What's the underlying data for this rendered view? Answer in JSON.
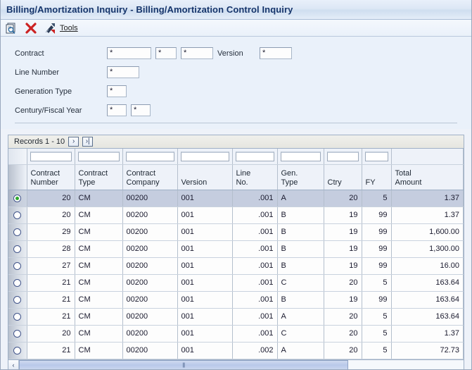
{
  "window": {
    "title": "Billing/Amortization Inquiry - Billing/Amortization Control Inquiry"
  },
  "toolbar": {
    "find_icon": "find-magnifier-icon",
    "delete_icon": "red-x-delete-icon",
    "tools_icon": "tools-wrench-icon",
    "tools_label": "Tools"
  },
  "form": {
    "rows": [
      {
        "label": "Contract",
        "fields": [
          "*",
          "*",
          "*"
        ],
        "second_label": "Version",
        "second_fields": [
          "*"
        ]
      },
      {
        "label": "Line Number",
        "fields": [
          "*"
        ]
      },
      {
        "label": "Generation Type",
        "fields": [
          "*"
        ]
      },
      {
        "label": "Century/Fiscal Year",
        "fields": [
          "*",
          "*"
        ]
      }
    ]
  },
  "grid": {
    "records_label": "Records  1 - 10",
    "next_button": "›",
    "last_button": "›|",
    "qbe_values": [
      "",
      "",
      "",
      "",
      "",
      "",
      "",
      ""
    ],
    "columns": [
      {
        "line1": "Contract",
        "line2": "Number",
        "align": "num"
      },
      {
        "line1": "Contract",
        "line2": "Type",
        "align": "txt"
      },
      {
        "line1": "Contract",
        "line2": "Company",
        "align": "txt"
      },
      {
        "line1": "",
        "line2": "Version",
        "align": "txt"
      },
      {
        "line1": "Line",
        "line2": "No.",
        "align": "num"
      },
      {
        "line1": "Gen.",
        "line2": "Type",
        "align": "txt"
      },
      {
        "line1": "",
        "line2": "Ctry",
        "align": "num"
      },
      {
        "line1": "",
        "line2": "FY",
        "align": "num"
      },
      {
        "line1": "Total",
        "line2": "Amount",
        "align": "num"
      }
    ],
    "rows": [
      {
        "selected": true,
        "contract_number": "20",
        "contract_type": "CM",
        "contract_company": "00200",
        "version": "001",
        "line_no": ".001",
        "gen_type": "A",
        "ctry": "20",
        "fy": "5",
        "total_amount": "1.37"
      },
      {
        "selected": false,
        "contract_number": "20",
        "contract_type": "CM",
        "contract_company": "00200",
        "version": "001",
        "line_no": ".001",
        "gen_type": "B",
        "ctry": "19",
        "fy": "99",
        "total_amount": "1.37"
      },
      {
        "selected": false,
        "contract_number": "29",
        "contract_type": "CM",
        "contract_company": "00200",
        "version": "001",
        "line_no": ".001",
        "gen_type": "B",
        "ctry": "19",
        "fy": "99",
        "total_amount": "1,600.00"
      },
      {
        "selected": false,
        "contract_number": "28",
        "contract_type": "CM",
        "contract_company": "00200",
        "version": "001",
        "line_no": ".001",
        "gen_type": "B",
        "ctry": "19",
        "fy": "99",
        "total_amount": "1,300.00"
      },
      {
        "selected": false,
        "contract_number": "27",
        "contract_type": "CM",
        "contract_company": "00200",
        "version": "001",
        "line_no": ".001",
        "gen_type": "B",
        "ctry": "19",
        "fy": "99",
        "total_amount": "16.00"
      },
      {
        "selected": false,
        "contract_number": "21",
        "contract_type": "CM",
        "contract_company": "00200",
        "version": "001",
        "line_no": ".001",
        "gen_type": "C",
        "ctry": "20",
        "fy": "5",
        "total_amount": "163.64"
      },
      {
        "selected": false,
        "contract_number": "21",
        "contract_type": "CM",
        "contract_company": "00200",
        "version": "001",
        "line_no": ".001",
        "gen_type": "B",
        "ctry": "19",
        "fy": "99",
        "total_amount": "163.64"
      },
      {
        "selected": false,
        "contract_number": "21",
        "contract_type": "CM",
        "contract_company": "00200",
        "version": "001",
        "line_no": ".001",
        "gen_type": "A",
        "ctry": "20",
        "fy": "5",
        "total_amount": "163.64"
      },
      {
        "selected": false,
        "contract_number": "20",
        "contract_type": "CM",
        "contract_company": "00200",
        "version": "001",
        "line_no": ".001",
        "gen_type": "C",
        "ctry": "20",
        "fy": "5",
        "total_amount": "1.37"
      },
      {
        "selected": false,
        "contract_number": "21",
        "contract_type": "CM",
        "contract_company": "00200",
        "version": "001",
        "line_no": ".002",
        "gen_type": "A",
        "ctry": "20",
        "fy": "5",
        "total_amount": "72.73"
      }
    ]
  },
  "scrollbar": {
    "left_arrow": "‹",
    "grip": "||||"
  },
  "colors": {
    "title_text": "#16356b",
    "panel_bg": "#eaf1fa",
    "selection": "#c5cddf",
    "radio_dot": "#2ea82e",
    "delete_icon": "#cc2222"
  }
}
